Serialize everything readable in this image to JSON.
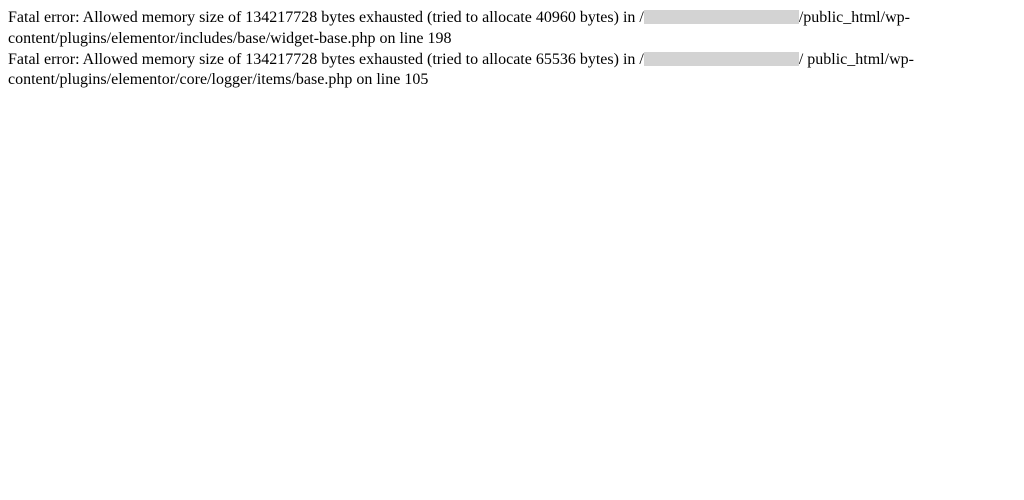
{
  "errors": [
    {
      "prefix": "Fatal error: Allowed memory size of 134217728 bytes exhausted (tried to allocate 40960 bytes) in /",
      "suffix_line1": "/public_html/wp-",
      "line2": "content/plugins/elementor/includes/base/widget-base.php on line 198"
    },
    {
      "prefix": "Fatal error: Allowed memory size of 134217728 bytes exhausted (tried to allocate 65536 bytes) in /",
      "suffix_line1": "/ public_html/wp-",
      "line2": "content/plugins/elementor/core/logger/items/base.php on line 105"
    }
  ]
}
